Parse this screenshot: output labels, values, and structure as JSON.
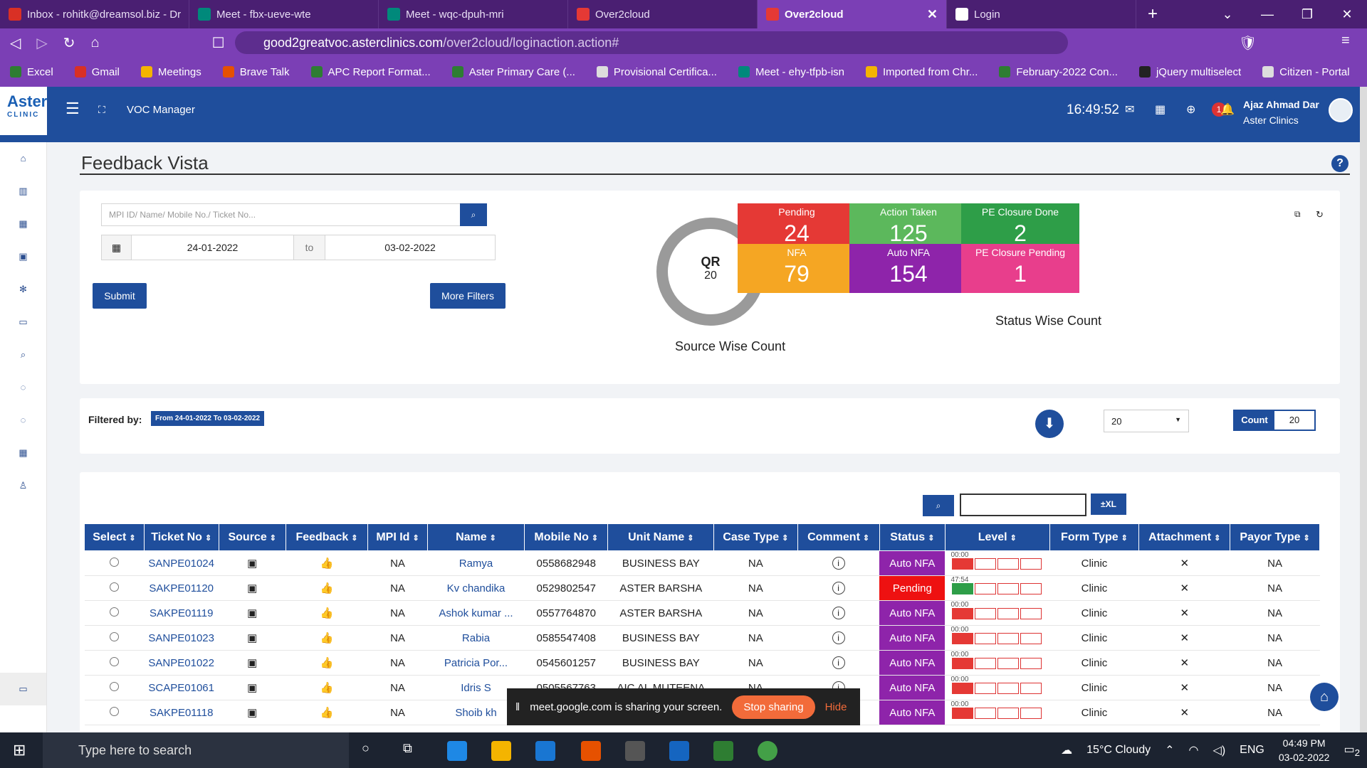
{
  "tabs": [
    {
      "label": "Inbox - rohitk@dreamsol.biz - Dr",
      "color": "#d93025"
    },
    {
      "label": "Meet - fbx-ueve-wte",
      "color": "#00897b"
    },
    {
      "label": "Meet - wqc-dpuh-mri",
      "color": "#00897b"
    },
    {
      "label": "Over2cloud",
      "color": "#e53935"
    },
    {
      "label": "Over2cloud",
      "color": "#e53935"
    },
    {
      "label": "Login",
      "color": "#ffffff"
    }
  ],
  "address": {
    "url_host": "good2greatvoc.asterclinics.com",
    "url_path": "/over2cloud/loginaction.action#"
  },
  "bookmarks": [
    "Excel",
    "Gmail",
    "Meetings",
    "Brave Talk",
    "APC Report Format...",
    "Aster Primary Care (...",
    "Provisional Certifica...",
    "Meet - ehy-tfpb-isn",
    "Imported from Chr...",
    "February-2022 Con...",
    "jQuery multiselect",
    "Citizen - Portal"
  ],
  "app": {
    "logo": "Aster",
    "logo_sub": "CLINIC",
    "module": "VOC Manager",
    "clock": "16:49:52",
    "notif_count": "1",
    "user_name": "Ajaz Ahmad Dar",
    "user_org": "Aster Clinics"
  },
  "page": {
    "title": "Feedback Vista",
    "help": "?"
  },
  "filters": {
    "search_placeholder": "MPI ID/ Name/ Mobile No./ Ticket No...",
    "date_from": "24-01-2022",
    "to_label": "to",
    "date_to": "03-02-2022",
    "submit": "Submit",
    "more_filters": "More Filters"
  },
  "source": {
    "center_label": "QR",
    "center_value": "20",
    "caption": "Source Wise Count"
  },
  "status": {
    "caption": "Status Wise Count",
    "tiles": [
      {
        "label": "Pending",
        "value": "24",
        "color": "#e53935"
      },
      {
        "label": "Action Taken",
        "value": "125",
        "color": "#5cb85c"
      },
      {
        "label": "PE Closure Done",
        "value": "2",
        "color": "#2e9e48"
      },
      {
        "label": "NFA",
        "value": "79",
        "color": "#f5a623"
      },
      {
        "label": "Auto NFA",
        "value": "154",
        "color": "#8e24aa"
      },
      {
        "label": "PE Closure Pending",
        "value": "1",
        "color": "#e83e8c"
      }
    ]
  },
  "filterbar": {
    "label": "Filtered by:",
    "chip": "From 24-01-2022 To 03-02-2022",
    "page_size": "20",
    "count_label": "Count",
    "count_value": "20"
  },
  "table": {
    "xl_label": "±XL",
    "headers": [
      "Select",
      "Ticket No",
      "Source",
      "Feedback",
      "MPI Id",
      "Name",
      "Mobile No",
      "Unit Name",
      "Case Type",
      "Comment",
      "Status",
      "Level",
      "Form Type",
      "Attachment",
      "Payor Type"
    ],
    "rows": [
      {
        "ticket": "SANPE01024",
        "mpi": "NA",
        "name": "Ramya",
        "mobile": "0558682948",
        "unit": "BUSINESS BAY",
        "case": "NA",
        "status": "Auto NFA",
        "status_color": "#8e24aa",
        "time": "00:00",
        "level_color": "#e53935",
        "form": "Clinic",
        "attach": "✕",
        "payor": "NA"
      },
      {
        "ticket": "SAKPE01120",
        "mpi": "NA",
        "name": "Kv chandika",
        "mobile": "0529802547",
        "unit": "ASTER BARSHA",
        "case": "NA",
        "status": "Pending",
        "status_color": "#ee1111",
        "time": "47:54",
        "level_color": "#2e9e48",
        "form": "Clinic",
        "attach": "✕",
        "payor": "NA"
      },
      {
        "ticket": "SAKPE01119",
        "mpi": "NA",
        "name": "Ashok kumar ...",
        "mobile": "0557764870",
        "unit": "ASTER BARSHA",
        "case": "NA",
        "status": "Auto NFA",
        "status_color": "#8e24aa",
        "time": "00:00",
        "level_color": "#e53935",
        "form": "Clinic",
        "attach": "✕",
        "payor": "NA"
      },
      {
        "ticket": "SANPE01023",
        "mpi": "NA",
        "name": "Rabia",
        "mobile": "0585547408",
        "unit": "BUSINESS BAY",
        "case": "NA",
        "status": "Auto NFA",
        "status_color": "#8e24aa",
        "time": "00:00",
        "level_color": "#e53935",
        "form": "Clinic",
        "attach": "✕",
        "payor": "NA"
      },
      {
        "ticket": "SANPE01022",
        "mpi": "NA",
        "name": "Patricia Por...",
        "mobile": "0545601257",
        "unit": "BUSINESS BAY",
        "case": "NA",
        "status": "Auto NFA",
        "status_color": "#8e24aa",
        "time": "00:00",
        "level_color": "#e53935",
        "form": "Clinic",
        "attach": "✕",
        "payor": "NA"
      },
      {
        "ticket": "SCAPE01061",
        "mpi": "NA",
        "name": "Idris S",
        "mobile": "0505567763",
        "unit": "AIC AL MUTEENA",
        "case": "NA",
        "status": "Auto NFA",
        "status_color": "#8e24aa",
        "time": "00:00",
        "level_color": "#e53935",
        "form": "Clinic",
        "attach": "✕",
        "payor": "NA"
      },
      {
        "ticket": "SAKPE01118",
        "mpi": "NA",
        "name": "Shoib kh",
        "mobile": "",
        "unit": "",
        "case": "",
        "status": "Auto NFA",
        "status_color": "#8e24aa",
        "time": "00:00",
        "level_color": "#e53935",
        "form": "Clinic",
        "attach": "✕",
        "payor": "NA"
      }
    ]
  },
  "sharebar": {
    "text": "meet.google.com is sharing your screen.",
    "stop": "Stop sharing",
    "hide": "Hide"
  },
  "taskbar": {
    "search": "Type here to search",
    "weather": "15°C  Cloudy",
    "lang": "ENG",
    "time": "04:49 PM",
    "date": "03-02-2022",
    "notif": "2"
  }
}
